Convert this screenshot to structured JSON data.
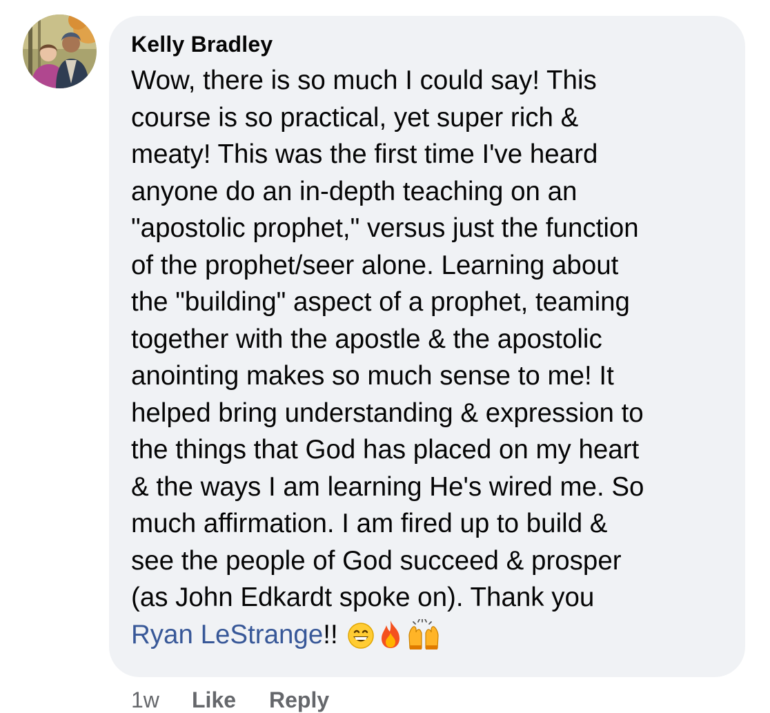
{
  "comment": {
    "author": "Kelly Bradley",
    "lines": [
      "Wow, there is so much I could say! This",
      "course is so practical, yet super rich &",
      "meaty! This was the first time I've heard",
      "anyone do an in-depth teaching on an",
      "\"apostolic prophet,\" versus just the function",
      "of the prophet/seer alone. Learning about",
      "the \"building\" aspect of a prophet, teaming",
      "together with the apostle & the apostolic",
      "anointing makes so much sense to me! It",
      "helped bring understanding & expression to",
      "the things that God has placed on my heart",
      "& the ways I am learning He's wired me. So",
      "much affirmation. I am fired up to build &",
      "see the people of God succeed & prosper",
      "(as John Edkardt spoke on). Thank you"
    ],
    "mention": "Ryan LeStrange",
    "after_mention": "!!",
    "emojis": [
      "grinning-face-emoji",
      "fire-emoji",
      "raising-hands-emoji"
    ]
  },
  "actions": {
    "time": "1w",
    "like": "Like",
    "reply": "Reply"
  },
  "colors": {
    "bubble": "#f0f2f5",
    "text": "#050505",
    "mention": "#385898",
    "meta": "#65676b"
  }
}
